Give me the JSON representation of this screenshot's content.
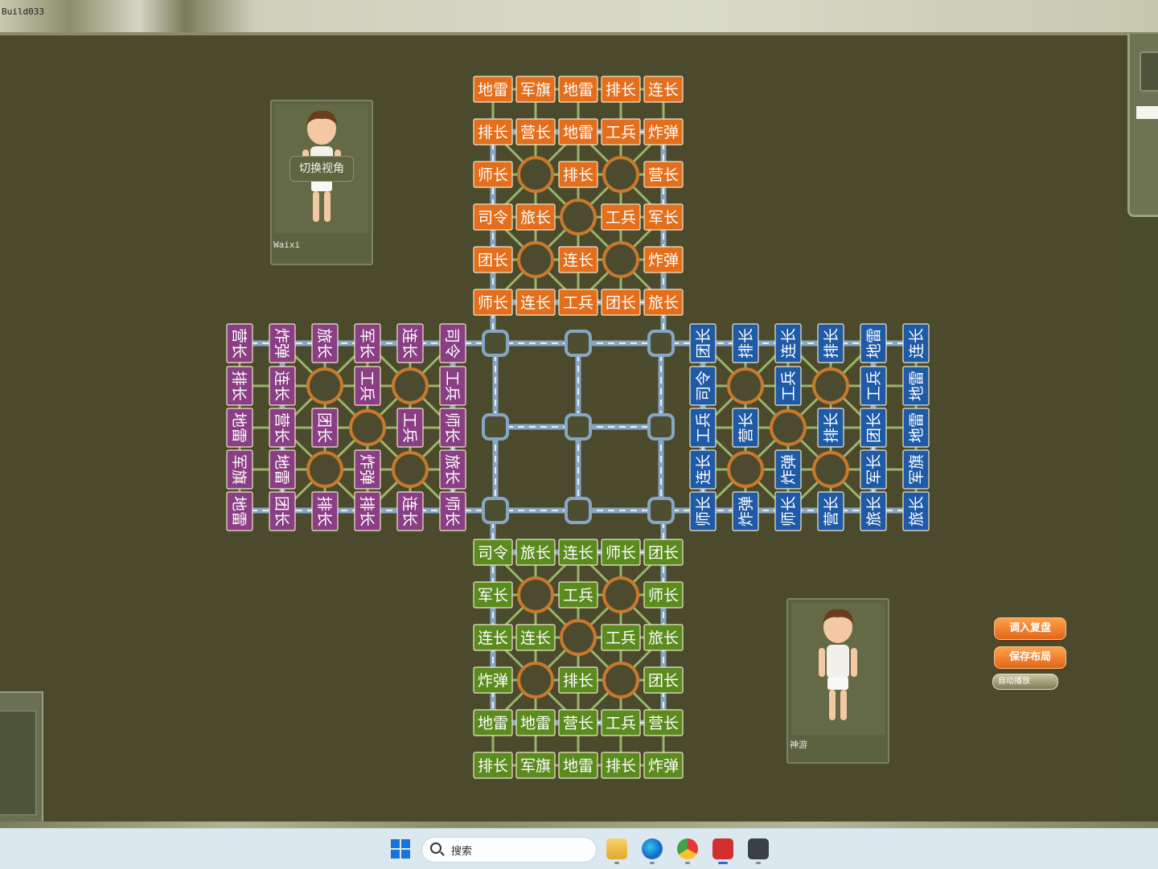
{
  "window": {
    "build_label": "Build033"
  },
  "top_player": {
    "name": "Waixi",
    "switch_view_label": "切换视角"
  },
  "bottom_player": {
    "name": "神游"
  },
  "buttons": {
    "load_replay": "调入复盘",
    "save_layout": "保存布局",
    "auto_play": "自动播放"
  },
  "taskbar": {
    "search_placeholder": "搜索"
  },
  "colors": {
    "orange": "#e36e1c",
    "purple": "#8a3f84",
    "blue": "#1f5aa6",
    "green": "#5b8b1e",
    "camp_ring": "#c9782c",
    "rail": "#86a6c4"
  },
  "camp_positions": [
    [
      1,
      1
    ],
    [
      1,
      3
    ],
    [
      2,
      2
    ],
    [
      3,
      1
    ],
    [
      3,
      3
    ]
  ],
  "boards": {
    "north": {
      "color": "orange",
      "rows": [
        [
          "地雷",
          "军旗",
          "地雷",
          "排长",
          "连长"
        ],
        [
          "排长",
          "营长",
          "地雷",
          "工兵",
          "炸弹"
        ],
        [
          "师长",
          "",
          "排长",
          "",
          "营长"
        ],
        [
          "司令",
          "旅长",
          "",
          "工兵",
          "军长"
        ],
        [
          "团长",
          "",
          "连长",
          "",
          "炸弹"
        ],
        [
          "师长",
          "连长",
          "工兵",
          "团长",
          "旅长"
        ]
      ]
    },
    "south": {
      "color": "green",
      "rows": [
        [
          "司令",
          "旅长",
          "连长",
          "师长",
          "团长"
        ],
        [
          "军长",
          "",
          "工兵",
          "",
          "师长"
        ],
        [
          "连长",
          "连长",
          "",
          "工兵",
          "旅长"
        ],
        [
          "炸弹",
          "",
          "排长",
          "",
          "团长"
        ],
        [
          "地雷",
          "地雷",
          "营长",
          "工兵",
          "营长"
        ],
        [
          "排长",
          "军旗",
          "地雷",
          "排长",
          "炸弹"
        ]
      ]
    },
    "west": {
      "color": "purple",
      "columns": [
        [
          "营长",
          "排长",
          "地雷",
          "军旗",
          "地雷"
        ],
        [
          "炸弹",
          "连长",
          "营长",
          "地雷",
          "团长"
        ],
        [
          "旅长",
          "",
          "团长",
          "",
          "排长"
        ],
        [
          "军长",
          "工兵",
          "",
          "炸弹",
          "排长"
        ],
        [
          "连长",
          "",
          "工兵",
          "",
          "连长"
        ],
        [
          "司令",
          "工兵",
          "师长",
          "旅长",
          "师长"
        ]
      ]
    },
    "east": {
      "color": "blue",
      "columns": [
        [
          "团长",
          "司令",
          "工兵",
          "连长",
          "师长"
        ],
        [
          "排长",
          "",
          "营长",
          "",
          "炸弹"
        ],
        [
          "连长",
          "工兵",
          "",
          "炸弹",
          "师长"
        ],
        [
          "排长",
          "",
          "排长",
          "",
          "营长"
        ],
        [
          "地雷",
          "工兵",
          "团长",
          "军长",
          "旅长"
        ],
        [
          "连长",
          "地雷",
          "地雷",
          "军旗",
          "旅长"
        ]
      ]
    }
  }
}
